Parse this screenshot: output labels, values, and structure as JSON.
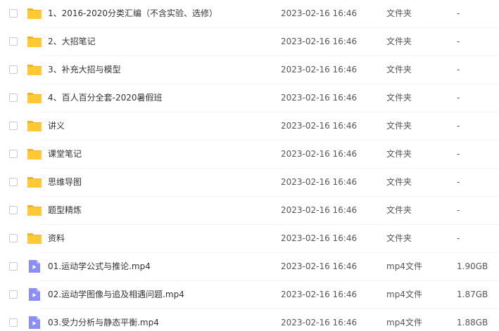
{
  "colors": {
    "folder": "#ffc933",
    "folder_tab": "#f5b21f",
    "video": "#8b8ff5",
    "video_fold": "#b9bcff"
  },
  "rows": [
    {
      "icon": "folder-icon",
      "name": "1、2016-2020分类汇编（不含实验、选修）",
      "date": "2023-02-16 16:46",
      "type": "文件夹",
      "size": "-"
    },
    {
      "icon": "folder-icon",
      "name": "2、大招笔记",
      "date": "2023-02-16 16:46",
      "type": "文件夹",
      "size": "-"
    },
    {
      "icon": "folder-icon",
      "name": "3、补充大招与模型",
      "date": "2023-02-16 16:46",
      "type": "文件夹",
      "size": "-"
    },
    {
      "icon": "folder-icon",
      "name": "4、百人百分全套-2020暑假班",
      "date": "2023-02-16 16:46",
      "type": "文件夹",
      "size": "-"
    },
    {
      "icon": "folder-icon",
      "name": "讲义",
      "date": "2023-02-16 16:46",
      "type": "文件夹",
      "size": "-"
    },
    {
      "icon": "folder-icon",
      "name": "课堂笔记",
      "date": "2023-02-16 16:46",
      "type": "文件夹",
      "size": "-"
    },
    {
      "icon": "folder-icon",
      "name": "思维导图",
      "date": "2023-02-16 16:46",
      "type": "文件夹",
      "size": "-"
    },
    {
      "icon": "folder-icon",
      "name": "题型精炼",
      "date": "2023-02-16 16:46",
      "type": "文件夹",
      "size": "-"
    },
    {
      "icon": "folder-icon",
      "name": "资料",
      "date": "2023-02-16 16:46",
      "type": "文件夹",
      "size": "-"
    },
    {
      "icon": "video-file-icon",
      "name": "01.运动学公式与推论.mp4",
      "date": "2023-02-16 16:46",
      "type": "mp4文件",
      "size": "1.90GB"
    },
    {
      "icon": "video-file-icon",
      "name": "02.运动学图像与追及相遇问题.mp4",
      "date": "2023-02-16 16:46",
      "type": "mp4文件",
      "size": "1.87GB"
    },
    {
      "icon": "video-file-icon",
      "name": "03.受力分析与静态平衡.mp4",
      "date": "2023-02-16 16:46",
      "type": "mp4文件",
      "size": "1.88GB"
    }
  ]
}
